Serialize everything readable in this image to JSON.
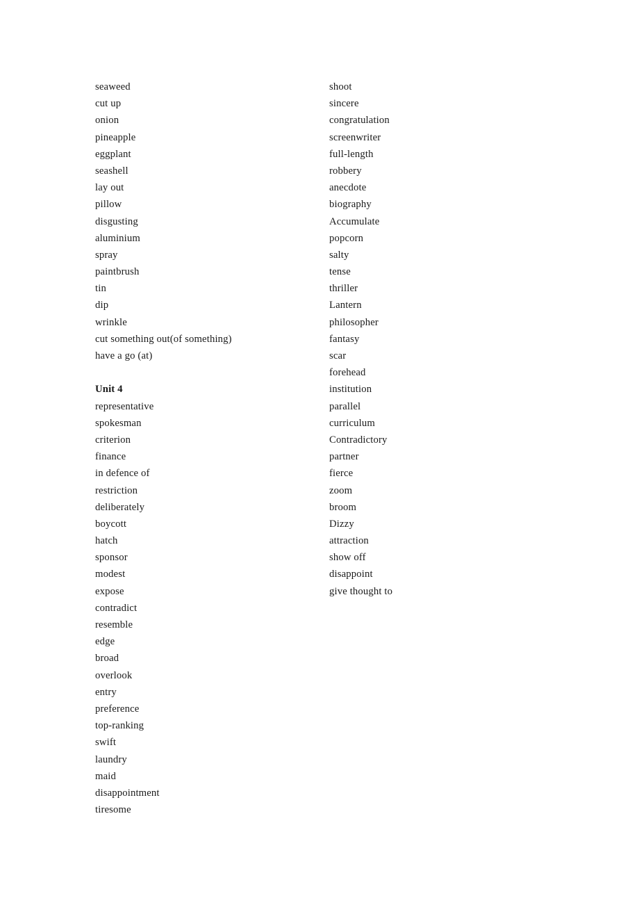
{
  "document": {
    "type": "vocabulary-word-list",
    "background_color": "#ffffff",
    "text_color": "#1a1a1a",
    "columns": 2
  },
  "left_column": {
    "lines": [
      {
        "text": "seaweed",
        "style": "normal"
      },
      {
        "text": "cut up",
        "style": "normal"
      },
      {
        "text": "onion",
        "style": "normal"
      },
      {
        "text": "pineapple",
        "style": "normal"
      },
      {
        "text": "eggplant",
        "style": "normal"
      },
      {
        "text": "seashell",
        "style": "normal"
      },
      {
        "text": "lay out",
        "style": "normal"
      },
      {
        "text": "pillow",
        "style": "normal"
      },
      {
        "text": "disgusting",
        "style": "normal"
      },
      {
        "text": "aluminium",
        "style": "normal"
      },
      {
        "text": "spray",
        "style": "normal"
      },
      {
        "text": "paintbrush",
        "style": "normal"
      },
      {
        "text": "tin",
        "style": "normal"
      },
      {
        "text": "dip",
        "style": "normal"
      },
      {
        "text": "wrinkle",
        "style": "normal"
      },
      {
        "text": "cut something out(of something)",
        "style": "normal"
      },
      {
        "text": "have a go (at)",
        "style": "normal"
      },
      {
        "text": "",
        "style": "spacer"
      },
      {
        "text": "Unit 4",
        "style": "heading"
      },
      {
        "text": "representative",
        "style": "normal"
      },
      {
        "text": "spokesman",
        "style": "normal"
      },
      {
        "text": "criterion",
        "style": "normal"
      },
      {
        "text": "finance",
        "style": "normal"
      },
      {
        "text": "in defence of",
        "style": "normal"
      },
      {
        "text": "restriction",
        "style": "normal"
      },
      {
        "text": "deliberately",
        "style": "normal"
      },
      {
        "text": "boycott",
        "style": "normal"
      },
      {
        "text": "hatch",
        "style": "normal"
      },
      {
        "text": "sponsor",
        "style": "normal"
      },
      {
        "text": "modest",
        "style": "normal"
      },
      {
        "text": "expose",
        "style": "normal"
      },
      {
        "text": "contradict",
        "style": "normal"
      },
      {
        "text": "resemble",
        "style": "normal"
      },
      {
        "text": "edge",
        "style": "normal"
      },
      {
        "text": "broad",
        "style": "normal"
      },
      {
        "text": "overlook",
        "style": "normal"
      },
      {
        "text": "entry",
        "style": "normal"
      },
      {
        "text": "preference",
        "style": "normal"
      },
      {
        "text": "top-ranking",
        "style": "normal"
      },
      {
        "text": "swift",
        "style": "normal"
      },
      {
        "text": "laundry",
        "style": "normal"
      },
      {
        "text": "maid",
        "style": "normal"
      },
      {
        "text": "disappointment",
        "style": "normal"
      },
      {
        "text": "tiresome",
        "style": "normal"
      }
    ]
  },
  "right_column": {
    "lines": [
      {
        "text": "shoot",
        "style": "normal"
      },
      {
        "text": "sincere",
        "style": "normal"
      },
      {
        "text": "congratulation",
        "style": "normal"
      },
      {
        "text": "screenwriter",
        "style": "normal"
      },
      {
        "text": "full-length",
        "style": "normal"
      },
      {
        "text": "robbery",
        "style": "normal"
      },
      {
        "text": "anecdote",
        "style": "normal"
      },
      {
        "text": "biography",
        "style": "normal"
      },
      {
        "text": "Accumulate",
        "style": "normal"
      },
      {
        "text": "popcorn",
        "style": "normal"
      },
      {
        "text": "salty",
        "style": "normal"
      },
      {
        "text": "tense",
        "style": "normal"
      },
      {
        "text": "thriller",
        "style": "normal"
      },
      {
        "text": "Lantern",
        "style": "normal"
      },
      {
        "text": "philosopher",
        "style": "normal"
      },
      {
        "text": "fantasy",
        "style": "normal"
      },
      {
        "text": "scar",
        "style": "normal"
      },
      {
        "text": "forehead",
        "style": "normal"
      },
      {
        "text": "institution",
        "style": "normal"
      },
      {
        "text": "parallel",
        "style": "normal"
      },
      {
        "text": "curriculum",
        "style": "normal"
      },
      {
        "text": "Contradictory",
        "style": "normal"
      },
      {
        "text": "partner",
        "style": "normal"
      },
      {
        "text": "fierce",
        "style": "normal"
      },
      {
        "text": "zoom",
        "style": "normal"
      },
      {
        "text": "broom",
        "style": "normal"
      },
      {
        "text": "Dizzy",
        "style": "normal"
      },
      {
        "text": "attraction",
        "style": "normal"
      },
      {
        "text": "show off",
        "style": "normal"
      },
      {
        "text": "disappoint",
        "style": "normal"
      },
      {
        "text": "give thought to",
        "style": "normal"
      }
    ]
  }
}
